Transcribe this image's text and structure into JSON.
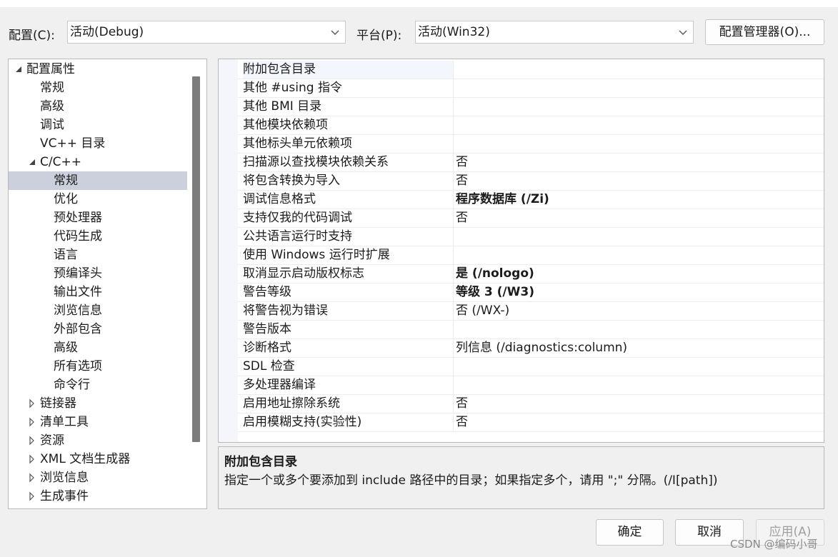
{
  "toolbar": {
    "config_label": "配置(C):",
    "config_value": "活动(Debug)",
    "platform_label": "平台(P):",
    "platform_value": "活动(Win32)",
    "manager_button": "配置管理器(O)..."
  },
  "tree": {
    "items": [
      {
        "label": "配置属性",
        "expander": "expanded"
      },
      {
        "label": "常规"
      },
      {
        "label": "高级"
      },
      {
        "label": "调试"
      },
      {
        "label": "VC++ 目录"
      },
      {
        "label": "C/C++",
        "expander": "expanded"
      },
      {
        "label": "常规",
        "selected": true
      },
      {
        "label": "优化"
      },
      {
        "label": "预处理器"
      },
      {
        "label": "代码生成"
      },
      {
        "label": "语言"
      },
      {
        "label": "预编译头"
      },
      {
        "label": "输出文件"
      },
      {
        "label": "浏览信息"
      },
      {
        "label": "外部包含"
      },
      {
        "label": "高级"
      },
      {
        "label": "所有选项"
      },
      {
        "label": "命令行"
      },
      {
        "label": "链接器",
        "expander": "collapsed"
      },
      {
        "label": "清单工具",
        "expander": "collapsed"
      },
      {
        "label": "资源",
        "expander": "collapsed"
      },
      {
        "label": "XML 文档生成器",
        "expander": "collapsed"
      },
      {
        "label": "浏览信息",
        "expander": "collapsed"
      },
      {
        "label": "生成事件",
        "expander": "collapsed"
      }
    ]
  },
  "properties": [
    {
      "name": "附加包含目录",
      "value": ""
    },
    {
      "name": "其他 #using 指令",
      "value": ""
    },
    {
      "name": "其他 BMI 目录",
      "value": ""
    },
    {
      "name": "其他模块依赖项",
      "value": ""
    },
    {
      "name": "其他标头单元依赖项",
      "value": ""
    },
    {
      "name": "扫描源以查找模块依赖关系",
      "value": "否"
    },
    {
      "name": "将包含转换为导入",
      "value": "否"
    },
    {
      "name": "调试信息格式",
      "value": "程序数据库 (/Zi)",
      "bold": true
    },
    {
      "name": "支持仅我的代码调试",
      "value": "否"
    },
    {
      "name": "公共语言运行时支持",
      "value": ""
    },
    {
      "name": "使用 Windows 运行时扩展",
      "value": ""
    },
    {
      "name": "取消显示启动版权标志",
      "value": "是 (/nologo)",
      "bold": true
    },
    {
      "name": "警告等级",
      "value": "等级 3 (/W3)",
      "bold": true
    },
    {
      "name": "将警告视为错误",
      "value": "否 (/WX-)"
    },
    {
      "name": "警告版本",
      "value": ""
    },
    {
      "name": "诊断格式",
      "value": "列信息 (/diagnostics:column)"
    },
    {
      "name": "SDL 检查",
      "value": ""
    },
    {
      "name": "多处理器编译",
      "value": ""
    },
    {
      "name": "启用地址擦除系统",
      "value": "否"
    },
    {
      "name": "启用模糊支持(实验性)",
      "value": "否"
    }
  ],
  "description": {
    "title": "附加包含目录",
    "text": "指定一个或多个要添加到 include 路径中的目录；如果指定多个，请用 \";\" 分隔。(/I[path])"
  },
  "buttons": {
    "ok": "确定",
    "cancel": "取消",
    "apply": "应用(A)"
  },
  "watermark": "CSDN @编码小哥",
  "colors": {
    "selection": "#ccd0dc",
    "disabled_text": "#a0a0a0"
  }
}
